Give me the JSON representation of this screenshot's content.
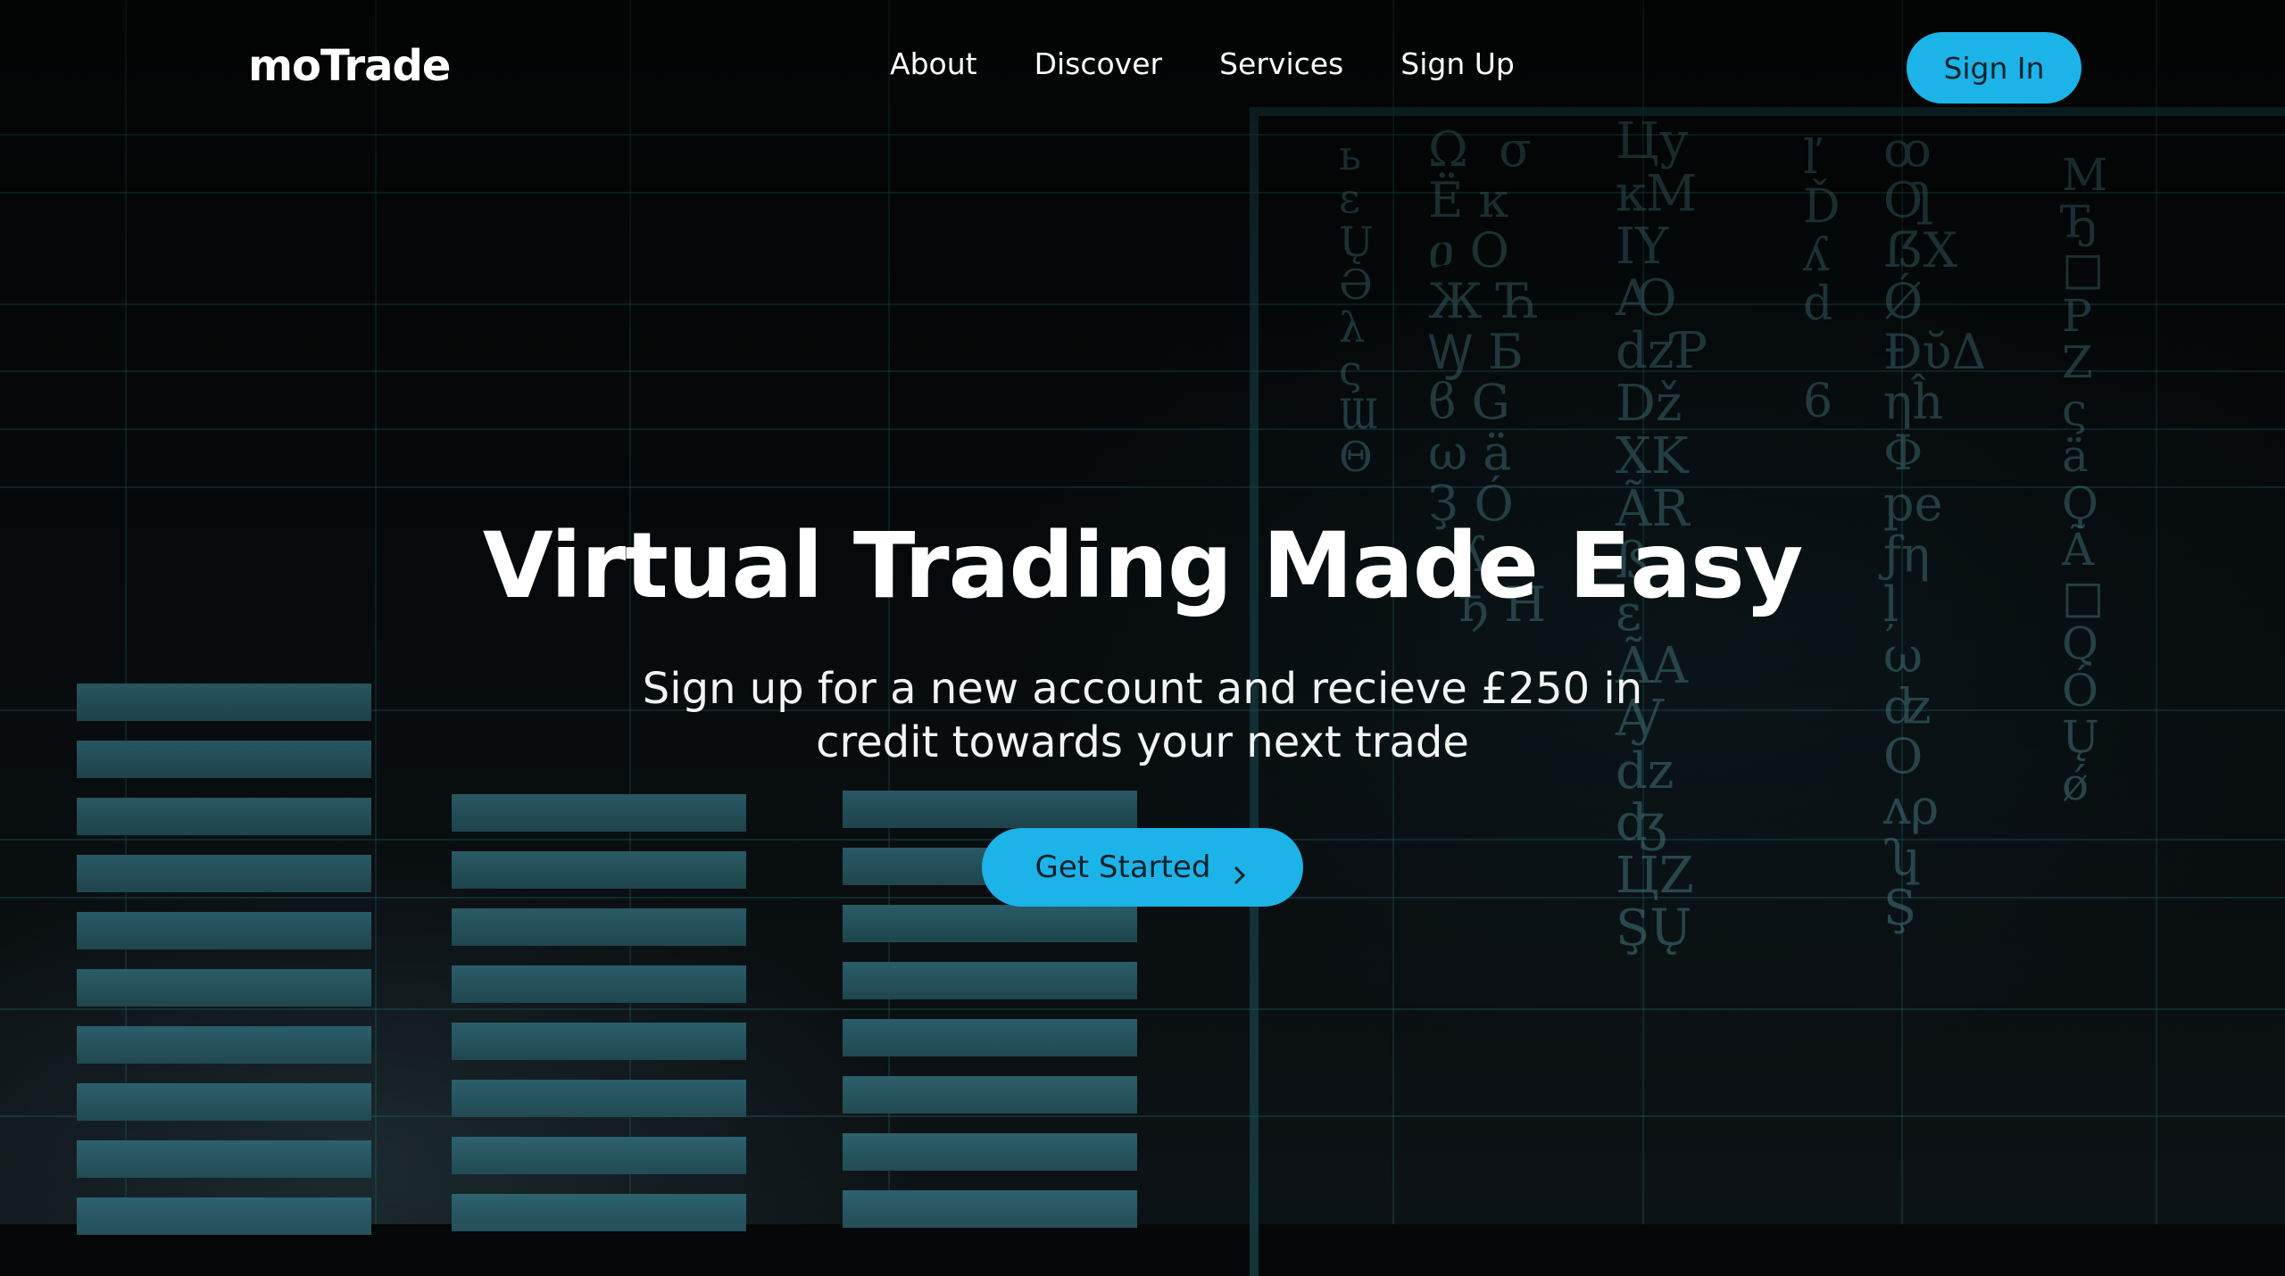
{
  "brand": {
    "name": "moTrade"
  },
  "nav": {
    "links": [
      {
        "label": "About"
      },
      {
        "label": "Discover"
      },
      {
        "label": "Services"
      },
      {
        "label": "Sign Up"
      }
    ],
    "signin_label": "Sign In"
  },
  "hero": {
    "title": "Virtual Trading Made Easy",
    "subtitle": "Sign up for a new account and recieve £250 in credit towards your next trade",
    "cta_label": "Get Started",
    "cta_icon": "chevron-right-icon"
  },
  "colors": {
    "accent": "#1cb3e8",
    "background": "#050708",
    "text": "#ffffff"
  }
}
